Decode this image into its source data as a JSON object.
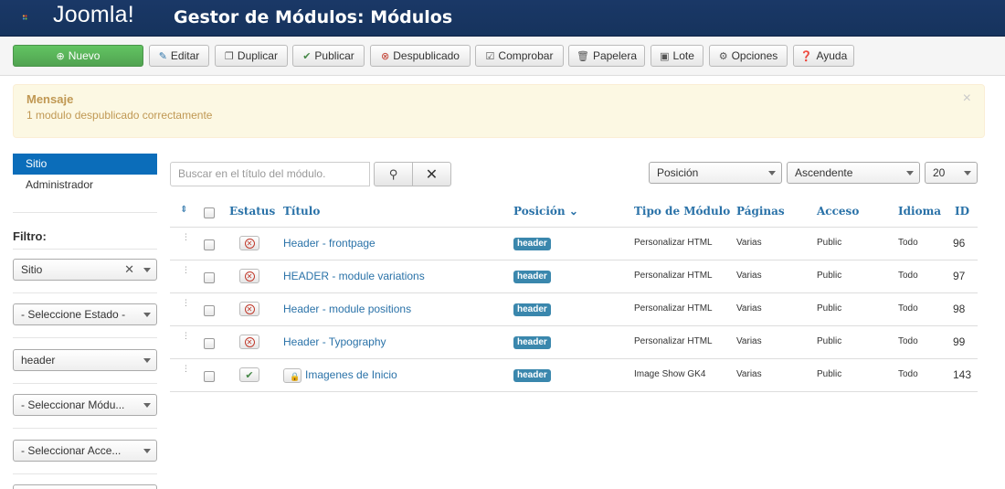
{
  "header": {
    "logo": "Joomla!",
    "title": "Gestor de Módulos: Módulos"
  },
  "toolbar": {
    "new": "Nuevo",
    "edit": "Editar",
    "duplicate": "Duplicar",
    "publish": "Publicar",
    "unpublish": "Despublicado",
    "checkin": "Comprobar",
    "trash": "Papelera",
    "batch": "Lote",
    "options": "Opciones",
    "help": "Ayuda"
  },
  "message": {
    "title": "Mensaje",
    "body": "1 modulo despublicado correctamente"
  },
  "sidebar": {
    "items": [
      "Sitio",
      "Administrador"
    ],
    "filter_label": "Filtro:",
    "filters": [
      "Sitio",
      "- Seleccione Estado -",
      "header",
      "- Seleccionar Módu...",
      "- Seleccionar Acce..."
    ]
  },
  "search": {
    "placeholder": "Buscar en el título del módulo."
  },
  "sort": {
    "field": "Posición",
    "direction": "Ascendente",
    "limit": "20"
  },
  "table": {
    "columns": {
      "status": "Estatus",
      "title": "Título",
      "position": "Posición",
      "type": "Tipo de Módulo",
      "pages": "Páginas",
      "access": "Acceso",
      "language": "Idioma",
      "id": "ID"
    },
    "rows": [
      {
        "title": "Header - frontpage",
        "position": "header",
        "type": "Personalizar HTML",
        "pages": "Varias",
        "access": "Public",
        "language": "Todo",
        "id": "96",
        "published": false,
        "locked": false
      },
      {
        "title": "HEADER - module variations",
        "position": "header",
        "type": "Personalizar HTML",
        "pages": "Varias",
        "access": "Public",
        "language": "Todo",
        "id": "97",
        "published": false,
        "locked": false
      },
      {
        "title": "Header - module positions",
        "position": "header",
        "type": "Personalizar HTML",
        "pages": "Varias",
        "access": "Public",
        "language": "Todo",
        "id": "98",
        "published": false,
        "locked": false
      },
      {
        "title": "Header - Typography",
        "position": "header",
        "type": "Personalizar HTML",
        "pages": "Varias",
        "access": "Public",
        "language": "Todo",
        "id": "99",
        "published": false,
        "locked": false
      },
      {
        "title": "Imagenes de Inicio",
        "position": "header",
        "type": "Image Show GK4",
        "pages": "Varias",
        "access": "Public",
        "language": "Todo",
        "id": "143",
        "published": true,
        "locked": true
      }
    ]
  }
}
